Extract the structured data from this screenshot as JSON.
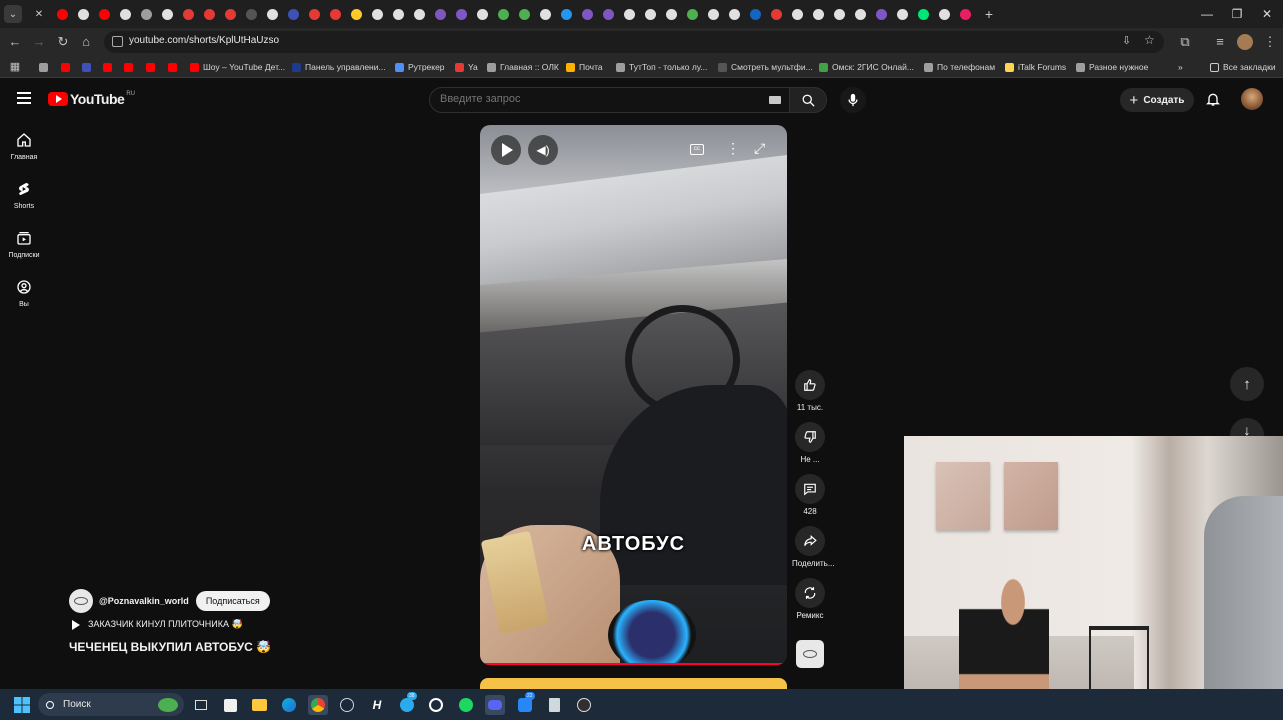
{
  "browser": {
    "url": "youtube.com/shorts/KplUtHaUzso",
    "tab_favicon_colors": [
      "#ff0000",
      "#e0e0e0",
      "#ff0000",
      "#e0e0e0",
      "#9e9e9e",
      "#e0e0e0",
      "#e53935",
      "#e53935",
      "#e53935",
      "#555",
      "#e0e0e0",
      "#3f51b5",
      "#e53935",
      "#e53935",
      "#ffca28",
      "#e0e0e0",
      "#e0e0e0",
      "#e0e0e0",
      "#7e57c2",
      "#7e57c2",
      "#e0e0e0",
      "#4caf50",
      "#4caf50",
      "#e0e0e0",
      "#2196f3",
      "#7e57c2",
      "#7e57c2",
      "#e0e0e0",
      "#e0e0e0",
      "#e0e0e0",
      "#4caf50",
      "#e0e0e0",
      "#e0e0e0",
      "#1565c0",
      "#e53935",
      "#e0e0e0",
      "#e0e0e0",
      "#e0e0e0",
      "#e0e0e0",
      "#7e57c2",
      "#e0e0e0",
      "#00e676",
      "#e0e0e0",
      "#e91e63"
    ],
    "bookmarks": [
      {
        "label": "",
        "color": "#9e9e9e"
      },
      {
        "label": "",
        "color": "#ff0000"
      },
      {
        "label": "",
        "color": "#3f51b5"
      },
      {
        "label": "",
        "color": "#ff0000"
      },
      {
        "label": "",
        "color": "#ff0000"
      },
      {
        "label": "",
        "color": "#ff0000"
      },
      {
        "label": "",
        "color": "#ff0000"
      },
      {
        "label": "Шоу – YouTube Дет...",
        "color": "#ff0000"
      },
      {
        "label": "Панель управлени...",
        "color": "#1e3a8a"
      },
      {
        "label": "Рутрекер",
        "color": "#4f8ff7"
      },
      {
        "label": "Ya",
        "color": "#e53935"
      },
      {
        "label": "Главная :: ОЛК",
        "color": "#9e9e9e"
      },
      {
        "label": "Почта",
        "color": "#ffb300"
      },
      {
        "label": "ТутТоп - только лу...",
        "color": "#9e9e9e"
      },
      {
        "label": "Смотреть мультфи...",
        "color": "#555"
      },
      {
        "label": "Омск: 2ГИС Онлай...",
        "color": "#43a047"
      },
      {
        "label": "По телефонам",
        "color": "#9e9e9e"
      },
      {
        "label": "iTalk Forums",
        "color": "#ffd54f"
      },
      {
        "label": "Разное нужное",
        "color": "#9e9e9e"
      }
    ],
    "all_bookmarks": "Все закладки"
  },
  "youtube": {
    "logo_text": "YouTube",
    "region": "RU",
    "search_placeholder": "Введите запрос",
    "create_label": "Создать",
    "sidebar": [
      {
        "label": "Главная",
        "icon": "home-icon"
      },
      {
        "label": "Shorts",
        "icon": "shorts-icon"
      },
      {
        "label": "Подписки",
        "icon": "subscriptions-icon"
      },
      {
        "label": "Вы",
        "icon": "you-icon"
      }
    ],
    "channel": "@Poznavalkin_world",
    "subscribe_label": "Подписаться",
    "playlist_line": "ЗАКАЗЧИК КИНУЛ ПЛИТОЧНИКА 🤯",
    "video_title": "ЧЕЧЕНЕЦ ВЫКУПИЛ АВТОБУС 🤯",
    "caption": "АВТОБУС",
    "actions": [
      {
        "label": "11 тыс.",
        "icon": "like-icon"
      },
      {
        "label": "Не ...",
        "icon": "dislike-icon"
      },
      {
        "label": "428",
        "icon": "comments-icon"
      },
      {
        "label": "Поделить...",
        "icon": "share-icon"
      },
      {
        "label": "Ремикс",
        "icon": "remix-icon"
      }
    ]
  },
  "taskbar": {
    "search_label": "Поиск",
    "badges": {
      "telegram": "38",
      "vk": "22"
    }
  }
}
